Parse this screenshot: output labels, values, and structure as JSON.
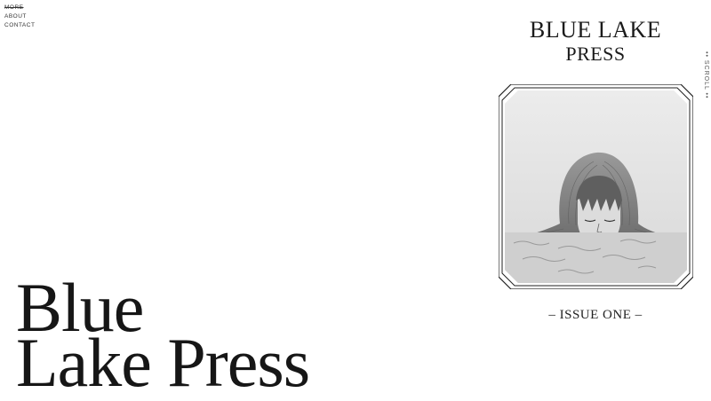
{
  "nav": {
    "items": [
      {
        "label": "MORE"
      },
      {
        "label": "ABOUT"
      },
      {
        "label": "CONTACT"
      }
    ]
  },
  "hero": {
    "line1": "Blue",
    "line2": "Lake Press"
  },
  "cover": {
    "title_line1": "BLUE LAKE",
    "title_line2": "PRESS",
    "issue": "– ISSUE ONE –",
    "image_icon": "illustration-woman-in-water"
  },
  "scroll": {
    "label": "•• SCROLL ••"
  }
}
